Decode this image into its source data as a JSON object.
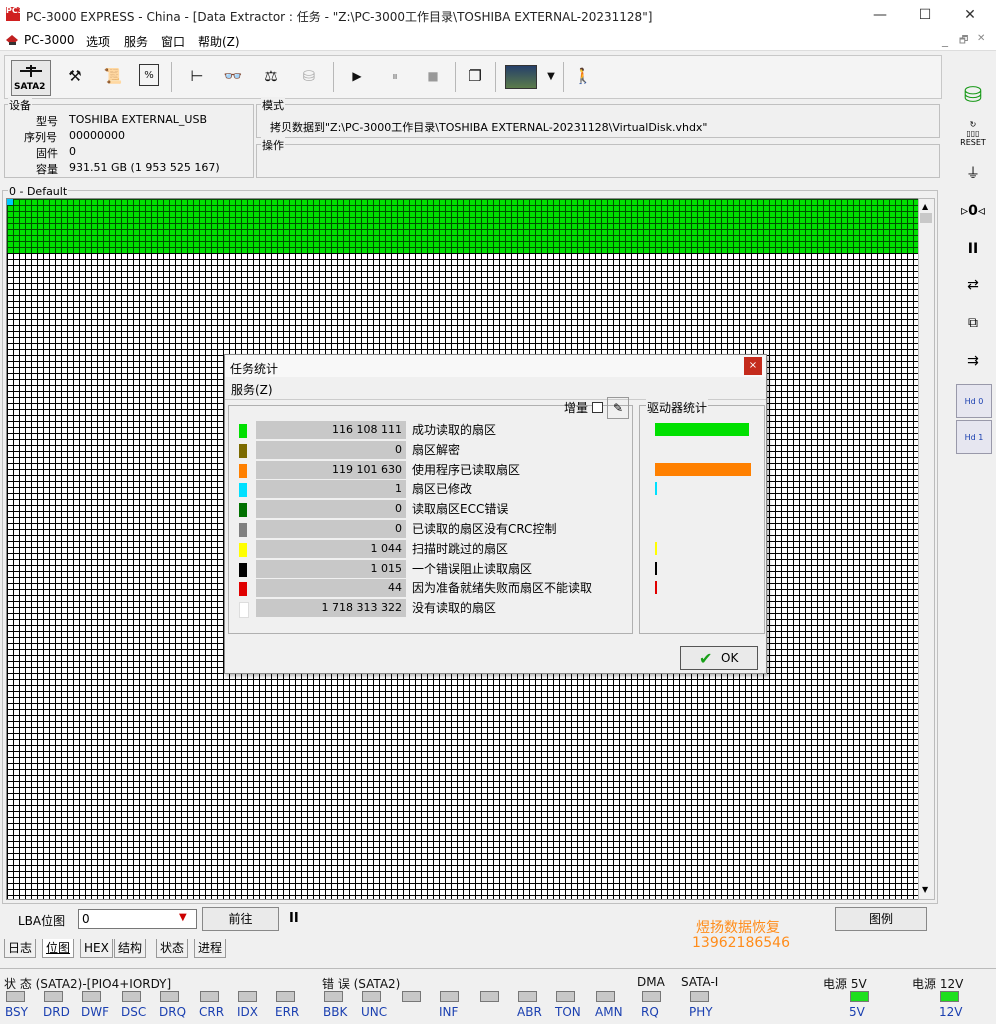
{
  "window": {
    "title": "PC-3000 EXPRESS - China - [Data Extractor : 任务 - \"Z:\\PC-3000工作目录\\TOSHIBA EXTERNAL-20231128\"]",
    "logo_text": "PC3K",
    "minimize": "—",
    "maximize": "☐",
    "close": "✕"
  },
  "menu": {
    "app": "PC-3000",
    "options": "选项",
    "service": "服务",
    "window": "窗口",
    "help": "帮助(Z)",
    "mdi_min": "_",
    "mdi_restore": "🗗",
    "mdi_close": "✕"
  },
  "toolbar": {
    "sata": "SATA2"
  },
  "device": {
    "title": "设备",
    "model_label": "型号",
    "model": "TOSHIBA EXTERNAL_USB",
    "serial_label": "序列号",
    "serial": "00000000",
    "firmware_label": "固件",
    "firmware": "0",
    "capacity_label": "容量",
    "capacity": "931.51 GB (1 953 525 167)"
  },
  "mode": {
    "title": "模式",
    "text": "拷贝数据到\"Z:\\PC-3000工作目录\\TOSHIBA EXTERNAL-20231128\\VirtualDisk.vhdx\""
  },
  "operation": {
    "title": "操作"
  },
  "map": {
    "title": "0 - Default"
  },
  "dialog": {
    "title": "任务统计",
    "menu": "服务(Z)",
    "increment_label": "增量",
    "drive_stats_title": "驱动器统计",
    "ok": "OK",
    "rows": [
      {
        "color": "#00e000",
        "value": "116 108 111",
        "label": "成功读取的扇区",
        "bar": 0.9
      },
      {
        "color": "#7b6a00",
        "value": "0",
        "label": "扇区解密",
        "bar": 0
      },
      {
        "color": "#ff8000",
        "value": "119 101 630",
        "label": "使用程序已读取扇区",
        "bar": 0.92
      },
      {
        "color": "#00e0ff",
        "value": "1",
        "label": "扇区已修改",
        "bar": 0.02
      },
      {
        "color": "#007000",
        "value": "0",
        "label": "读取扇区ECC错误",
        "bar": 0
      },
      {
        "color": "#808080",
        "value": "0",
        "label": "已读取的扇区没有CRC控制",
        "bar": 0
      },
      {
        "color": "#ffff00",
        "value": "1 044",
        "label": "扫描时跳过的扇区",
        "bar": 0.02
      },
      {
        "color": "#000000",
        "value": "1 015",
        "label": "一个错误阻止读取扇区",
        "bar": 0.02
      },
      {
        "color": "#e00000",
        "value": "44",
        "label": "因为准备就绪失败而扇区不能读取",
        "bar": 0.02
      },
      {
        "color": "#ffffff",
        "value": "1 718 313 322",
        "label": "没有读取的扇区",
        "bar": 0
      }
    ]
  },
  "lba": {
    "label": "LBA位图",
    "value": "0",
    "go": "前往",
    "pause": "II",
    "legend": "图例"
  },
  "watermark": {
    "line1": "煜扬数据恢复",
    "line2": "13962186546"
  },
  "tabs": [
    "日志",
    "位图",
    "HEX",
    "结构",
    "状态",
    "进程"
  ],
  "status": {
    "status_title": "状 态 (SATA2)-[PIO4+IORDY]",
    "error_title": "错 误 (SATA2)",
    "dma_title": "DMA",
    "sata_title": "SATA-I",
    "power5_title": "电源 5V",
    "power12_title": "电源 12V",
    "status_leds": [
      "BSY",
      "DRD",
      "DWF",
      "DSC",
      "DRQ",
      "CRR",
      "IDX",
      "ERR"
    ],
    "error_leds": [
      "BBK",
      "UNC",
      "",
      "INF",
      "",
      "ABR",
      "TON",
      "AMN"
    ],
    "dma_led": "RQ",
    "sata_led": "PHY",
    "power5": "5V",
    "power12": "12V"
  }
}
